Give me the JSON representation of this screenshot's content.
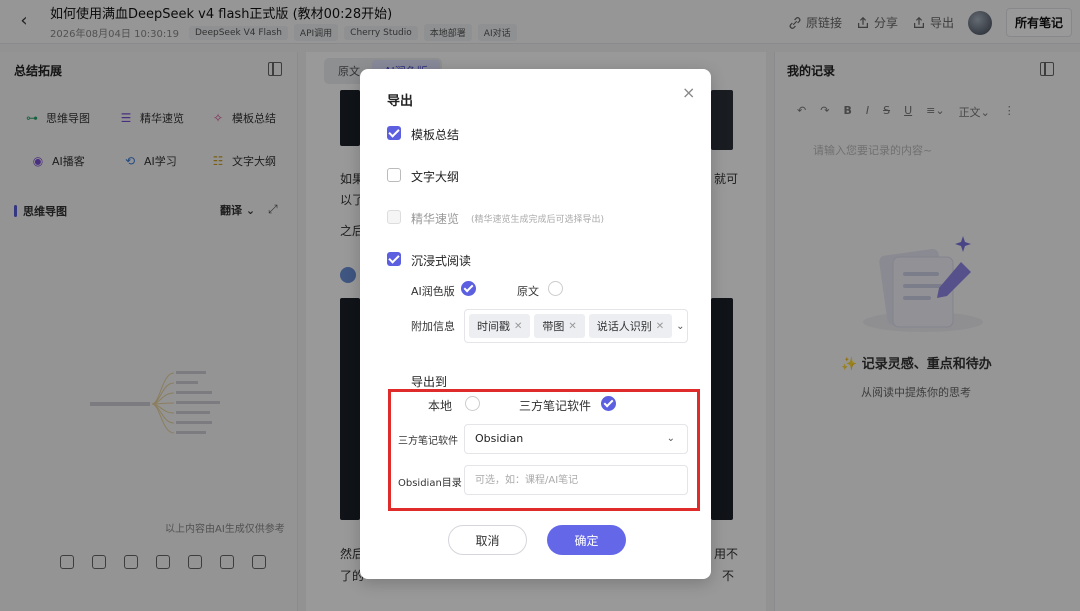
{
  "header": {
    "title": "如何使用满血DeepSeek v4 flash正式版 (教材00:28开始)",
    "date": "2026年08月04日 10:30:19",
    "tags": [
      "DeepSeek V4 Flash",
      "API调用",
      "Cherry Studio",
      "本地部署",
      "AI对话"
    ],
    "actions": {
      "link": "原链接",
      "share": "分享",
      "export": "导出"
    },
    "all_notes": "所有笔记"
  },
  "left": {
    "title": "总结拓展",
    "tools": [
      "思维导图",
      "精华速览",
      "模板总结",
      "AI播客",
      "AI学习",
      "文字大纲"
    ],
    "section": "思维导图",
    "translate": "翻译",
    "disclaimer": "以上内容由AI生成仅供参考"
  },
  "middle": {
    "tabs": [
      "原文",
      "AI润色版"
    ],
    "text1": "如果",
    "text1_end": "就可",
    "text2": "以了",
    "text3": "之后",
    "text4": "然后",
    "text4_end": "用不",
    "text5": "了的",
    "text5_end": "不"
  },
  "right": {
    "title": "我的记录",
    "style_label": "正文",
    "placeholder": "请输入您要记录的内容~",
    "headline": "记录灵感、重点和待办",
    "subline": "从阅读中提炼你的思考"
  },
  "dialog": {
    "title": "导出",
    "close": "×",
    "opt_template": "模板总结",
    "opt_outline": "文字大纲",
    "opt_essence": "精华速览",
    "opt_essence_note": "(精华速览生成完成后可选择导出)",
    "opt_immersive": "沉浸式阅读",
    "ai_version": "AI润色版",
    "original": "原文",
    "extra_info": "附加信息",
    "chips": [
      "时间戳",
      "带图",
      "说话人识别"
    ],
    "export_to": "导出到",
    "local": "本地",
    "third_party": "三方笔记软件",
    "third_party_label": "三方笔记软件",
    "third_party_value": "Obsidian",
    "dir_label": "Obsidian目录",
    "dir_placeholder": "可选，如：课程/AI笔记",
    "cancel": "取消",
    "confirm": "确定"
  }
}
